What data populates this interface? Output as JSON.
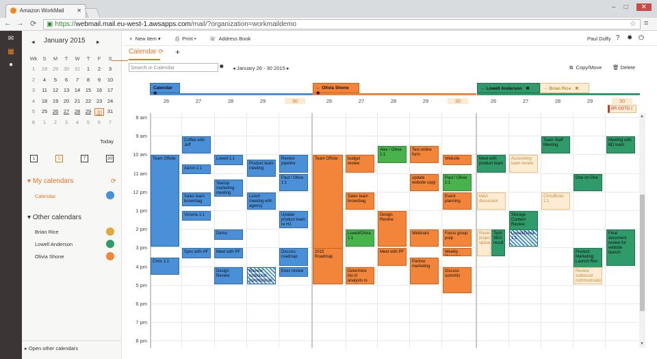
{
  "browser": {
    "tab_title": "Amazon WorkMail",
    "url_https": "https://",
    "url_host": "webmail.mail.eu-west-1.awsapps.com",
    "url_path": "/mail/?organization=workmaildemo"
  },
  "toolbar": {
    "new_item": "New item",
    "print": "Print",
    "address_book": "Address Book",
    "user": "Paul Duffy"
  },
  "minical": {
    "month": "January 2015",
    "headers": [
      "Wk",
      "S",
      "M",
      "T",
      "W",
      "T",
      "F",
      "S"
    ],
    "rows": [
      [
        "1",
        "28",
        "29",
        "30",
        "31",
        "1",
        "2",
        "3"
      ],
      [
        "2",
        "4",
        "5",
        "6",
        "7",
        "8",
        "9",
        "10"
      ],
      [
        "3",
        "11",
        "12",
        "13",
        "14",
        "15",
        "16",
        "17"
      ],
      [
        "4",
        "18",
        "19",
        "20",
        "21",
        "22",
        "23",
        "24"
      ],
      [
        "5",
        "25",
        "26",
        "27",
        "28",
        "29",
        "30",
        "31"
      ],
      [
        "6",
        "1",
        "2",
        "3",
        "4",
        "5",
        "6",
        "7"
      ]
    ],
    "today": "Today",
    "views": [
      "1",
      "5",
      "7",
      "30"
    ]
  },
  "sidebar": {
    "my_calendars": "My calendars",
    "calendar": "Calendar",
    "other_calendars": "Other calendars",
    "others": [
      {
        "name": "Brian Rice",
        "color": "#e0a93b"
      },
      {
        "name": "Lowell Anderson",
        "color": "#2f9a6a"
      },
      {
        "name": "Olivia Shone",
        "color": "#f2853a"
      }
    ],
    "open_other": "Open other calendars"
  },
  "main": {
    "tab": "Calendar",
    "search_placeholder": "Search in Calendar",
    "date_range": "January 26 - 30 2015",
    "copymove": "Copy/Move",
    "delete": "Delete",
    "headers": [
      "Calendar",
      "Olivia Shone",
      "Lowell Anderson",
      "Brian Rice"
    ],
    "days": [
      "26",
      "27",
      "28",
      "29",
      "30"
    ],
    "hours": [
      "8 am",
      "9 am",
      "10 am",
      "11 am",
      "12 pm",
      "1 pm",
      "2 pm",
      "3 pm",
      "4 pm",
      "5 pm",
      "6 pm",
      "7 pm",
      "8 pm"
    ],
    "allday_event": "BR OOTO ("
  },
  "events": [
    {
      "label": "Coffee with Jeff"
    },
    {
      "label": "Team Offsite"
    },
    {
      "label": "Lowell 1:1"
    },
    {
      "label": "Review pipeline"
    },
    {
      "label": "Aaron 1:1"
    },
    {
      "label": "Product team meeting"
    },
    {
      "label": "Paul / Olivia 1:1"
    },
    {
      "label": "Startup marketing meeting"
    },
    {
      "label": "Sales team brownbag"
    },
    {
      "label": "Lunch meeting with agency"
    },
    {
      "label": "Victoria 1:1"
    },
    {
      "label": "Update product team re H1"
    },
    {
      "label": "Demo"
    },
    {
      "label": "Sync with HF"
    },
    {
      "label": "Meet with PF"
    },
    {
      "label": "Discuss roadmap"
    },
    {
      "label": "Chris 1:1"
    },
    {
      "label": "Design Review"
    },
    {
      "label": "Review outbound communicati"
    },
    {
      "label": "Exec review"
    },
    {
      "label": "Team Offsite"
    },
    {
      "label": "budget review"
    },
    {
      "label": "Alex / Olivia 1:1"
    },
    {
      "label": "Test online form"
    },
    {
      "label": "Website"
    },
    {
      "label": "update website copy"
    },
    {
      "label": "Paul / Olivia 1:1"
    },
    {
      "label": "Sales team brownbag"
    },
    {
      "label": "Event planning"
    },
    {
      "label": "Design Review"
    },
    {
      "label": "Lowell/Olivia 1:1"
    },
    {
      "label": "Webinars"
    },
    {
      "label": "Focus group prep"
    },
    {
      "label": "2015 Roadmap"
    },
    {
      "label": "Meet with PF"
    },
    {
      "label": "Weekly Planning"
    },
    {
      "label": "Partner marketing"
    },
    {
      "label": "Determine list of analysts to brief"
    },
    {
      "label": "Discuss summits"
    },
    {
      "label": "Meet with product team"
    },
    {
      "label": "Accounting team review"
    },
    {
      "label": "Team Staff Meeting"
    },
    {
      "label": "Meeting with BD team"
    },
    {
      "label": "One on One"
    },
    {
      "label": "M&A discussion"
    },
    {
      "label": "Chris/Brian 1:1"
    },
    {
      "label": "Storage Content Review"
    },
    {
      "label": "Revie project spread"
    },
    {
      "label": "Tech SEO result"
    },
    {
      "label": "Lowell/Olivia 1:1"
    },
    {
      "label": "Final document review for website launch"
    },
    {
      "label": "Product Marketing Launch Rev"
    },
    {
      "label": "Review outbound communicatio"
    }
  ]
}
